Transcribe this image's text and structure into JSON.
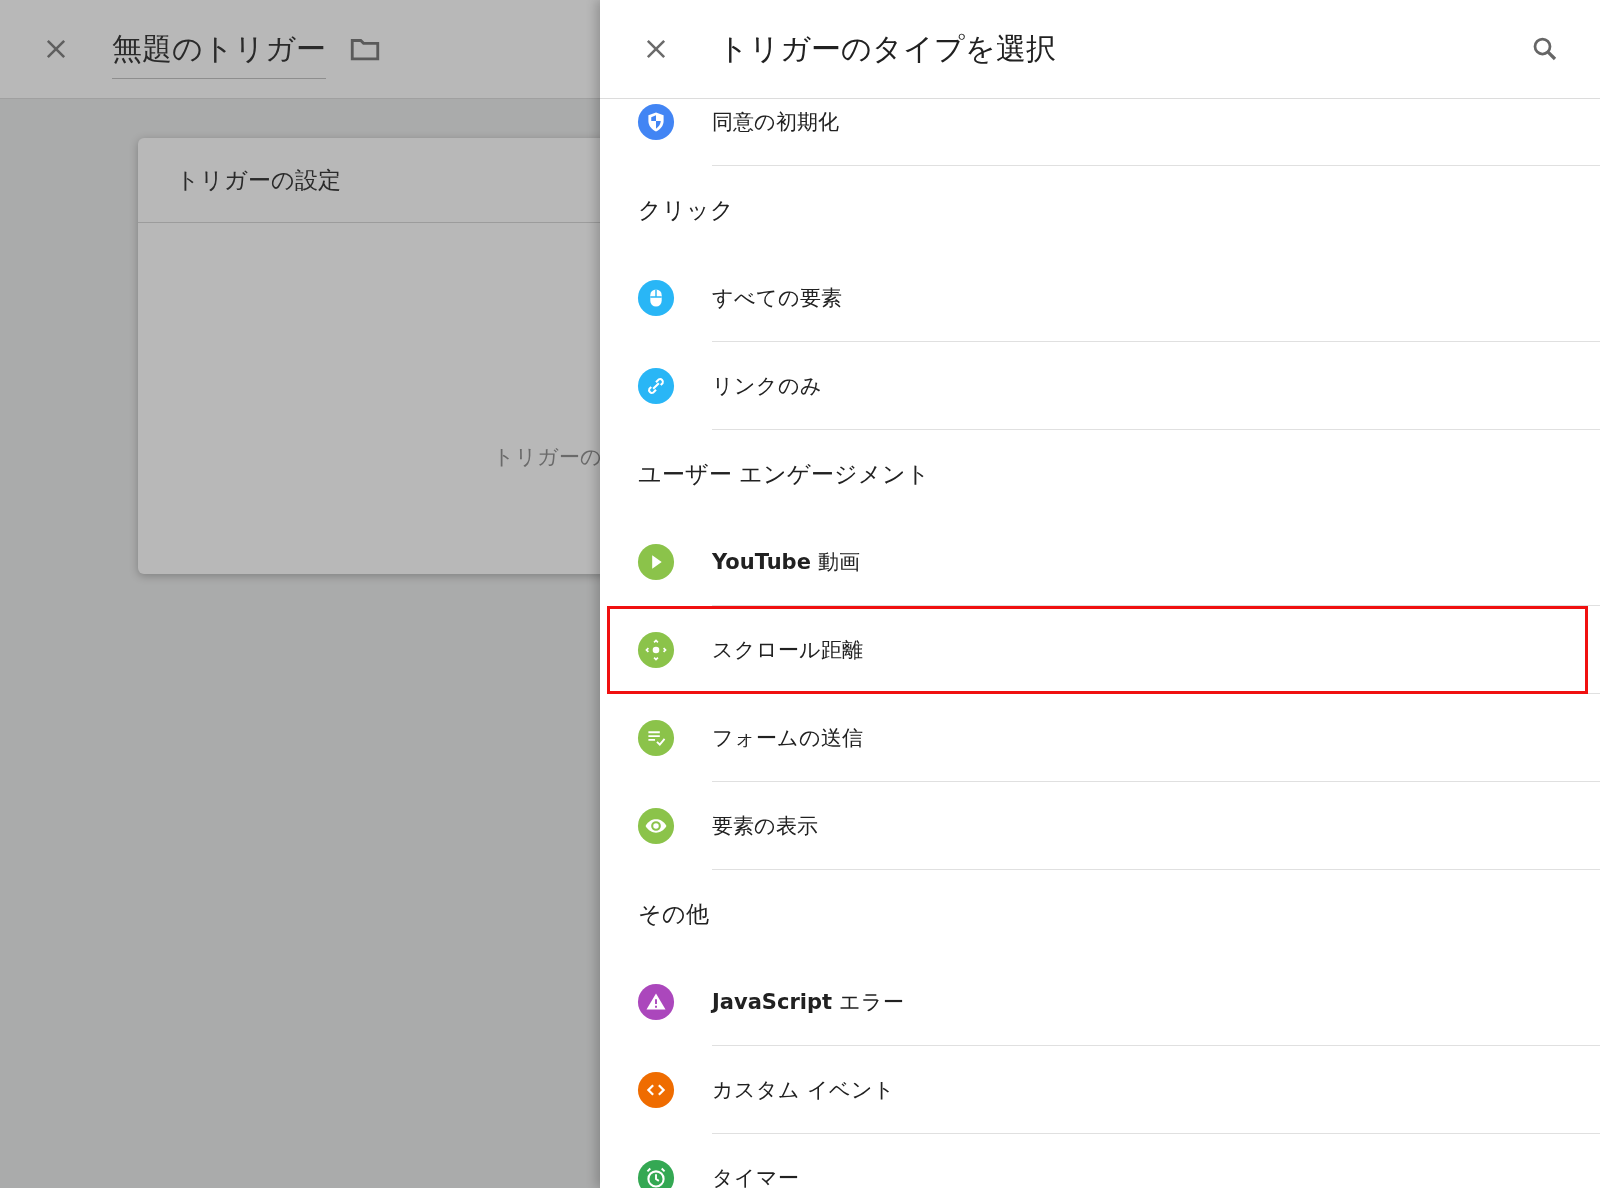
{
  "background": {
    "title": "無題のトリガー",
    "card": {
      "title": "トリガーの設定",
      "hint": "トリガーの"
    }
  },
  "panel": {
    "title": "トリガーのタイプを選択",
    "sections": [
      {
        "items": [
          {
            "label": "同意の初期化",
            "color": "#4285f4",
            "highlighted": false
          }
        ]
      },
      {
        "heading": "クリック",
        "items": [
          {
            "label": "すべての要素",
            "color": "#29b6f6",
            "highlighted": false
          },
          {
            "label": "リンクのみ",
            "color": "#29b6f6",
            "highlighted": false
          }
        ]
      },
      {
        "heading": "ユーザー エンゲージメント",
        "items": [
          {
            "label": "**YouTube** 動画",
            "color": "#8bc34a",
            "highlighted": false
          },
          {
            "label": "スクロール距離",
            "color": "#8bc34a",
            "highlighted": true
          },
          {
            "label": "フォームの送信",
            "color": "#8bc34a",
            "highlighted": false
          },
          {
            "label": "要素の表示",
            "color": "#8bc34a",
            "highlighted": false
          }
        ]
      },
      {
        "heading": "その他",
        "items": [
          {
            "label": "**JavaScript** エラー",
            "color": "#ab47bc",
            "highlighted": false
          },
          {
            "label": "カスタム イベント",
            "color": "#ef6c00",
            "highlighted": false
          },
          {
            "label": "タイマー",
            "color": "#34a853",
            "highlighted": false
          }
        ]
      }
    ]
  }
}
